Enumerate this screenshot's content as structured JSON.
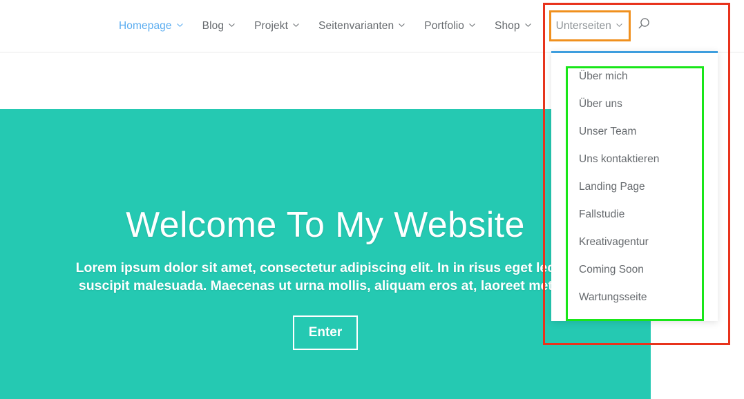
{
  "header": {
    "nav_items": [
      {
        "label": "Homepage",
        "has_caret": true,
        "active": true
      },
      {
        "label": "Blog",
        "has_caret": true,
        "active": false
      },
      {
        "label": "Projekt",
        "has_caret": true,
        "active": false
      },
      {
        "label": "Seitenvarianten",
        "has_caret": true,
        "active": false
      },
      {
        "label": "Portfolio",
        "has_caret": true,
        "active": false
      },
      {
        "label": "Shop",
        "has_caret": true,
        "active": false
      }
    ],
    "highlighted_item": {
      "label": "Unterseiten",
      "has_caret": true
    },
    "search_icon": "search-icon"
  },
  "dropdown": {
    "items": [
      {
        "label": "Über mich"
      },
      {
        "label": "Über uns"
      },
      {
        "label": "Unser Team"
      },
      {
        "label": "Uns kontaktieren"
      },
      {
        "label": "Landing Page"
      },
      {
        "label": "Fallstudie"
      },
      {
        "label": "Kreativagentur"
      },
      {
        "label": "Coming Soon"
      },
      {
        "label": "Wartungsseite"
      }
    ]
  },
  "hero": {
    "title": "Welcome To My Website",
    "subtitle": "Lorem ipsum dolor sit amet, consectetur adipiscing elit. In in risus eget lectus suscipit malesuada. Maecenas ut urna mollis, aliquam eros at, laoreet metus.",
    "cta_label": "Enter"
  },
  "colors": {
    "hero_background": "#25c9b2",
    "nav_active": "#5badf0",
    "nav_text": "#666a6e",
    "dropdown_top_border": "#3e9ede",
    "annotation_red": "#e8331c",
    "annotation_orange": "#f0901e",
    "annotation_green": "#19e619"
  }
}
